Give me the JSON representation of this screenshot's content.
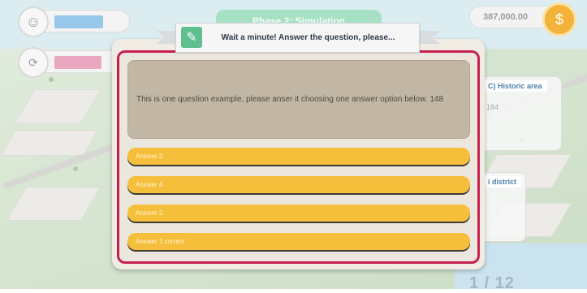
{
  "hud": {
    "money": "387,000.00",
    "stage_tab": "Phase 2: Simulation",
    "page_counter": "1 / 12",
    "icons": {
      "happiness": "smiley-icon",
      "refresh": "refresh-icon",
      "money": "money-bag-icon"
    }
  },
  "side_panel": {
    "area_title": "C) Historic area",
    "area_value": "184",
    "district_title": "i district"
  },
  "modal": {
    "title": "Wait a minute! Answer the question, please...",
    "icon": "pencil-icon",
    "question": "This is one question example, please anser it choosing one answer option below. 148",
    "answers": [
      "Answer 3",
      "Answer 4",
      "Answer 2",
      "Answer 1 correct"
    ]
  },
  "colors": {
    "modal_border": "#c6204f",
    "answer_fill": "#f6bf3b",
    "question_fill": "#c2b7a5",
    "ribbon_icon": "#5fbf8e"
  }
}
